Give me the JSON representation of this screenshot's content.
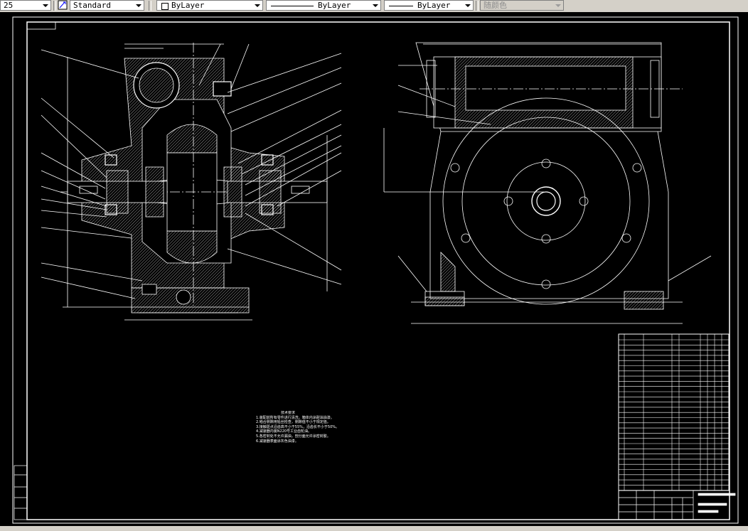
{
  "toolbar": {
    "scale_value": "25",
    "text_style": "Standard",
    "layer": "ByLayer",
    "linetype": "ByLayer",
    "lineweight": "ByLayer",
    "plot_style": "随颜色"
  },
  "drawing": {
    "colors": {
      "background": "#000000",
      "lines": "#ffffff",
      "toolbar": "#d4d0c8"
    },
    "tech_requirements_title": "技术要求",
    "tech_requirements": [
      "1.装配前所有零件进行清洗，箱体内涂耐油油漆。",
      "2.啮合侧隙用铅丝检查，侧隙值不小于规定值。",
      "3.接触斑点沿齿高不小于55%，沿齿长不小于50%。",
      "4.减速器内装N220号工业齿轮油。",
      "5.各密封处不允许漏油，剖分面允许涂密封胶。",
      "6.减速器表面涂灰色油漆。"
    ]
  }
}
